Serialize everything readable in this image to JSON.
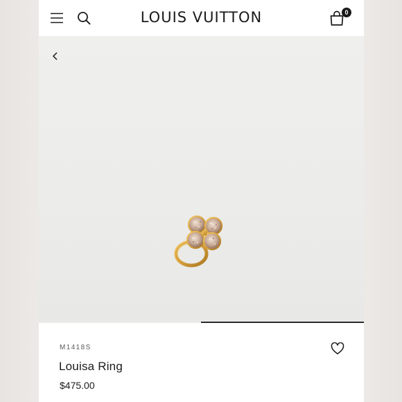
{
  "header": {
    "brand": "LOUIS VUITTON",
    "bag_count": "0",
    "icons": [
      "menu-icon",
      "search-icon",
      "shopping-bag-icon"
    ]
  },
  "gallery": {
    "back_icon": "chevron-left-icon",
    "image": "louisa-ring-product-image",
    "slide": 2,
    "slide_count": 2
  },
  "product": {
    "sku": "M1418S",
    "name": "Louisa Ring",
    "price": "$475.00",
    "wishlist_icon": "heart-icon"
  },
  "colors": {
    "text": "#1a1a1a",
    "backdrop": "#ece9e6",
    "image_bg": "#ececea",
    "gold": "#d9a441"
  }
}
